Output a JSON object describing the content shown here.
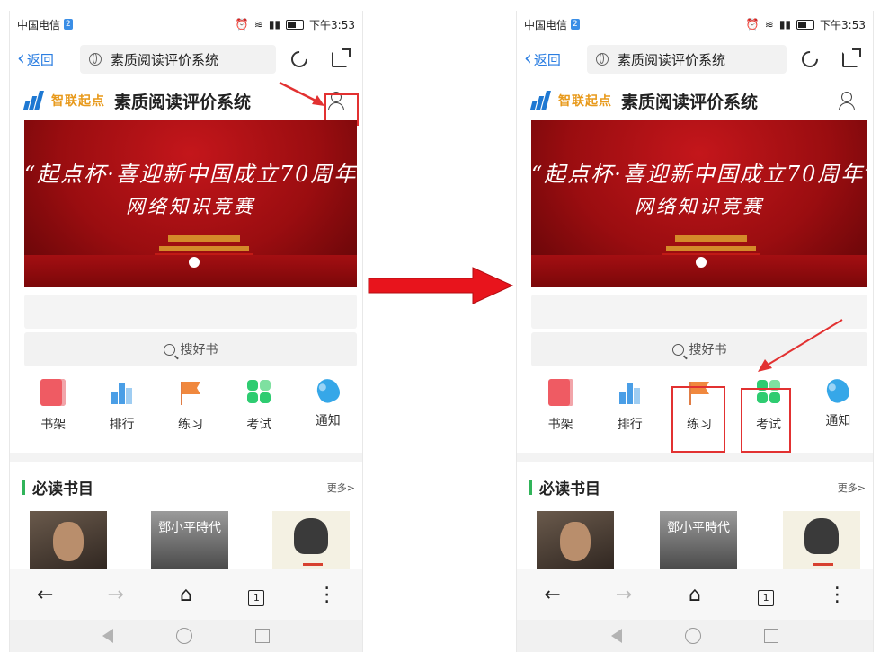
{
  "status": {
    "carrier": "中国电信",
    "sim_badge": "2",
    "time": "下午3:53"
  },
  "toolbar": {
    "back_label": "返回",
    "url_title": "素质阅读评价系统"
  },
  "site": {
    "logo_text": "智联起点",
    "title": "素质阅读评价系统"
  },
  "banner": {
    "line1": "“起点杯·喜迎新中国成立70周年”",
    "line2": "网络知识竞赛"
  },
  "search": {
    "placeholder": "搜好书"
  },
  "quicknav": [
    {
      "label": "书架",
      "icon": "bookshelf-icon"
    },
    {
      "label": "排行",
      "icon": "ranking-icon"
    },
    {
      "label": "练习",
      "icon": "flag-icon"
    },
    {
      "label": "考试",
      "icon": "exam-grid-icon"
    },
    {
      "label": "通知",
      "icon": "bell-icon"
    }
  ],
  "section": {
    "title": "必读书目",
    "more": "更多>"
  },
  "books": [
    {
      "cover_title": ""
    },
    {
      "cover_title": "鄧小平時代"
    },
    {
      "cover_title": ""
    }
  ],
  "navbar": {
    "tabs_count": "1"
  },
  "colors": {
    "accent_blue": "#2a7de1",
    "highlight_red": "#e23131",
    "banner_red": "#c4161b",
    "section_green": "#31b45a"
  }
}
